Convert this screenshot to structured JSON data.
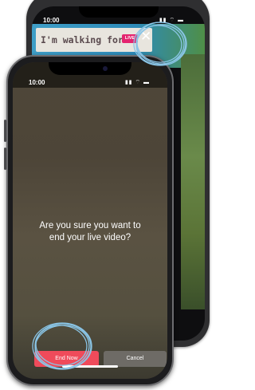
{
  "back_phone": {
    "status_time": "10:00",
    "status_icons": "▮▮ ⌔ ▬",
    "video_sign_text": "I'm walking for",
    "live_badge": "LIVE",
    "close_glyph": "✕"
  },
  "front_phone": {
    "status_time": "10:00",
    "status_icons": "▮▮ ⌔ ▬",
    "prompt_line1": "Are you sure you want to",
    "prompt_line2": "end your live video?",
    "end_button": "End Now",
    "cancel_button": "Cancel"
  },
  "colors": {
    "live_badge": "#e4246f",
    "end_button": "#ef4b5b",
    "cancel_button": "#6e6b66",
    "highlight": "#8ac5e6"
  }
}
